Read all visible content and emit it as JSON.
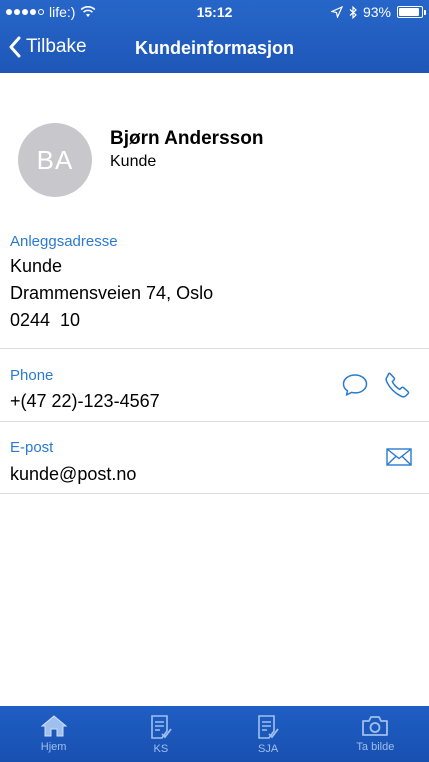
{
  "status": {
    "carrier": "life:)",
    "time": "15:12",
    "battery_text": "93%",
    "battery_level": 0.93
  },
  "nav": {
    "back_label": "Tilbake",
    "title": "Kundeinformasjon"
  },
  "profile": {
    "initials": "BA",
    "name": "Bjørn Andersson",
    "role": "Kunde"
  },
  "address": {
    "label": "Anleggsadresse",
    "line1": "Kunde",
    "line2": "Drammensveien 74, Oslo",
    "line3": "0244  10"
  },
  "phone": {
    "label": "Phone",
    "value": "+(47 22)-123-4567"
  },
  "email": {
    "label": "E-post",
    "value": "kunde@post.no"
  },
  "tabs": [
    {
      "label": "Hjem",
      "icon": "home-icon"
    },
    {
      "label": "KS",
      "icon": "checklist-icon"
    },
    {
      "label": "SJA",
      "icon": "checklist-icon"
    },
    {
      "label": "Ta bilde",
      "icon": "camera-icon"
    }
  ],
  "colors": {
    "bar": "#1e57b8",
    "accent": "#2a7ad1",
    "tab_inactive": "#9fc0ee",
    "avatar_bg": "#c8c7cc"
  }
}
